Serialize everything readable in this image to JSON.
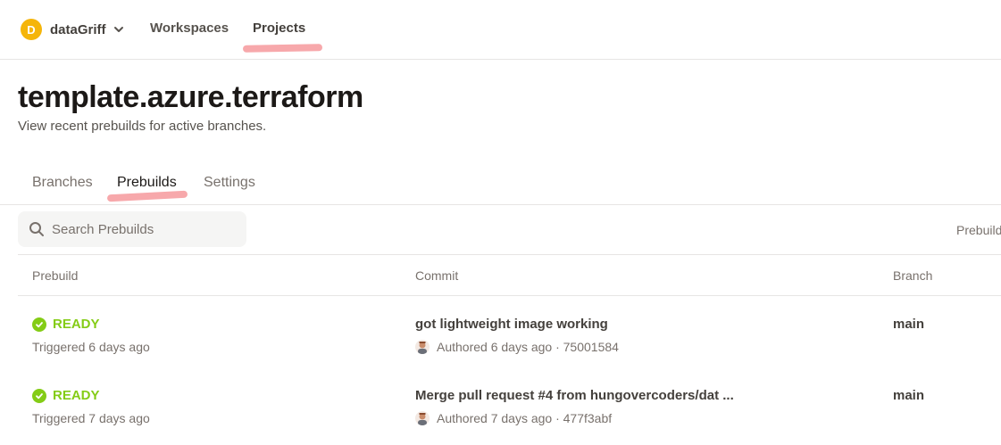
{
  "nav": {
    "account_initial": "D",
    "account_name": "dataGriff",
    "links": [
      "Workspaces",
      "Projects"
    ]
  },
  "header": {
    "title": "template.azure.terraform",
    "subtitle": "View recent prebuilds for active branches."
  },
  "tabs": [
    "Branches",
    "Prebuilds",
    "Settings"
  ],
  "search": {
    "placeholder": "Search Prebuilds",
    "value": ""
  },
  "filter_label": "Prebuild",
  "table": {
    "columns": [
      "Prebuild",
      "Commit",
      "Branch"
    ],
    "rows": [
      {
        "status": "READY",
        "triggered": "Triggered 6 days ago",
        "commit_message": "got lightweight image working",
        "commit_meta": "Authored 6 days ago · 75001584",
        "branch": "main"
      },
      {
        "status": "READY",
        "triggered": "Triggered 7 days ago",
        "commit_message": "Merge pull request #4 from hungovercoders/dat ...",
        "commit_meta": "Authored 7 days ago · 477f3abf",
        "branch": "main"
      }
    ]
  },
  "colors": {
    "ready": "#84cc16",
    "highlight": "#f7a8ab",
    "avatar": "#f5b50a"
  }
}
